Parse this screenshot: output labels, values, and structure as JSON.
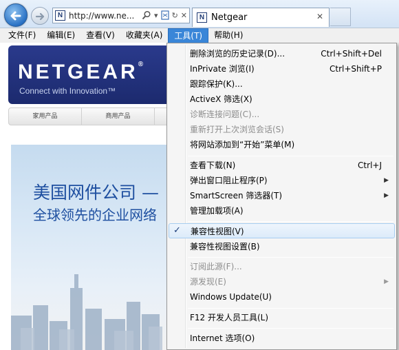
{
  "browser": {
    "address": "http://www.ne...",
    "tab_title": "Netgear",
    "favicon_letter": "N"
  },
  "menubar": {
    "items": [
      {
        "label": "文件(F)"
      },
      {
        "label": "编辑(E)"
      },
      {
        "label": "查看(V)"
      },
      {
        "label": "收藏夹(A)"
      },
      {
        "label": "工具(T)",
        "active": true
      },
      {
        "label": "帮助(H)"
      }
    ]
  },
  "page": {
    "logo": "NETGEAR",
    "reg_mark": "®",
    "tagline": "Connect with Innovation™",
    "nav": [
      "家用产品",
      "商用产品"
    ],
    "headline1": "美国网件公司 —",
    "headline2": "全球领先的企业网络"
  },
  "tools_menu": {
    "items": [
      {
        "label": "删除浏览的历史记录(D)...",
        "shortcut": "Ctrl+Shift+Del"
      },
      {
        "label": "InPrivate 浏览(I)",
        "shortcut": "Ctrl+Shift+P"
      },
      {
        "label": "跟踪保护(K)..."
      },
      {
        "label": "ActiveX 筛选(X)"
      },
      {
        "label": "诊断连接问题(C)...",
        "disabled": true
      },
      {
        "label": "重新打开上次浏览会话(S)",
        "disabled": true
      },
      {
        "label": "将网站添加到“开始”菜单(M)"
      },
      {
        "label": "查看下载(N)",
        "shortcut": "Ctrl+J"
      },
      {
        "label": "弹出窗口阻止程序(P)",
        "submenu": true
      },
      {
        "label": "SmartScreen 筛选器(T)",
        "submenu": true
      },
      {
        "label": "管理加载项(A)"
      },
      {
        "label": "兼容性视图(V)",
        "checked": true
      },
      {
        "label": "兼容性视图设置(B)"
      },
      {
        "label": "订阅此源(F)...",
        "disabled": true
      },
      {
        "label": "源发现(E)",
        "disabled": true,
        "submenu": true
      },
      {
        "label": "Windows Update(U)"
      },
      {
        "label": "F12 开发人员工具(L)"
      },
      {
        "label": "Internet 选项(O)"
      }
    ]
  }
}
